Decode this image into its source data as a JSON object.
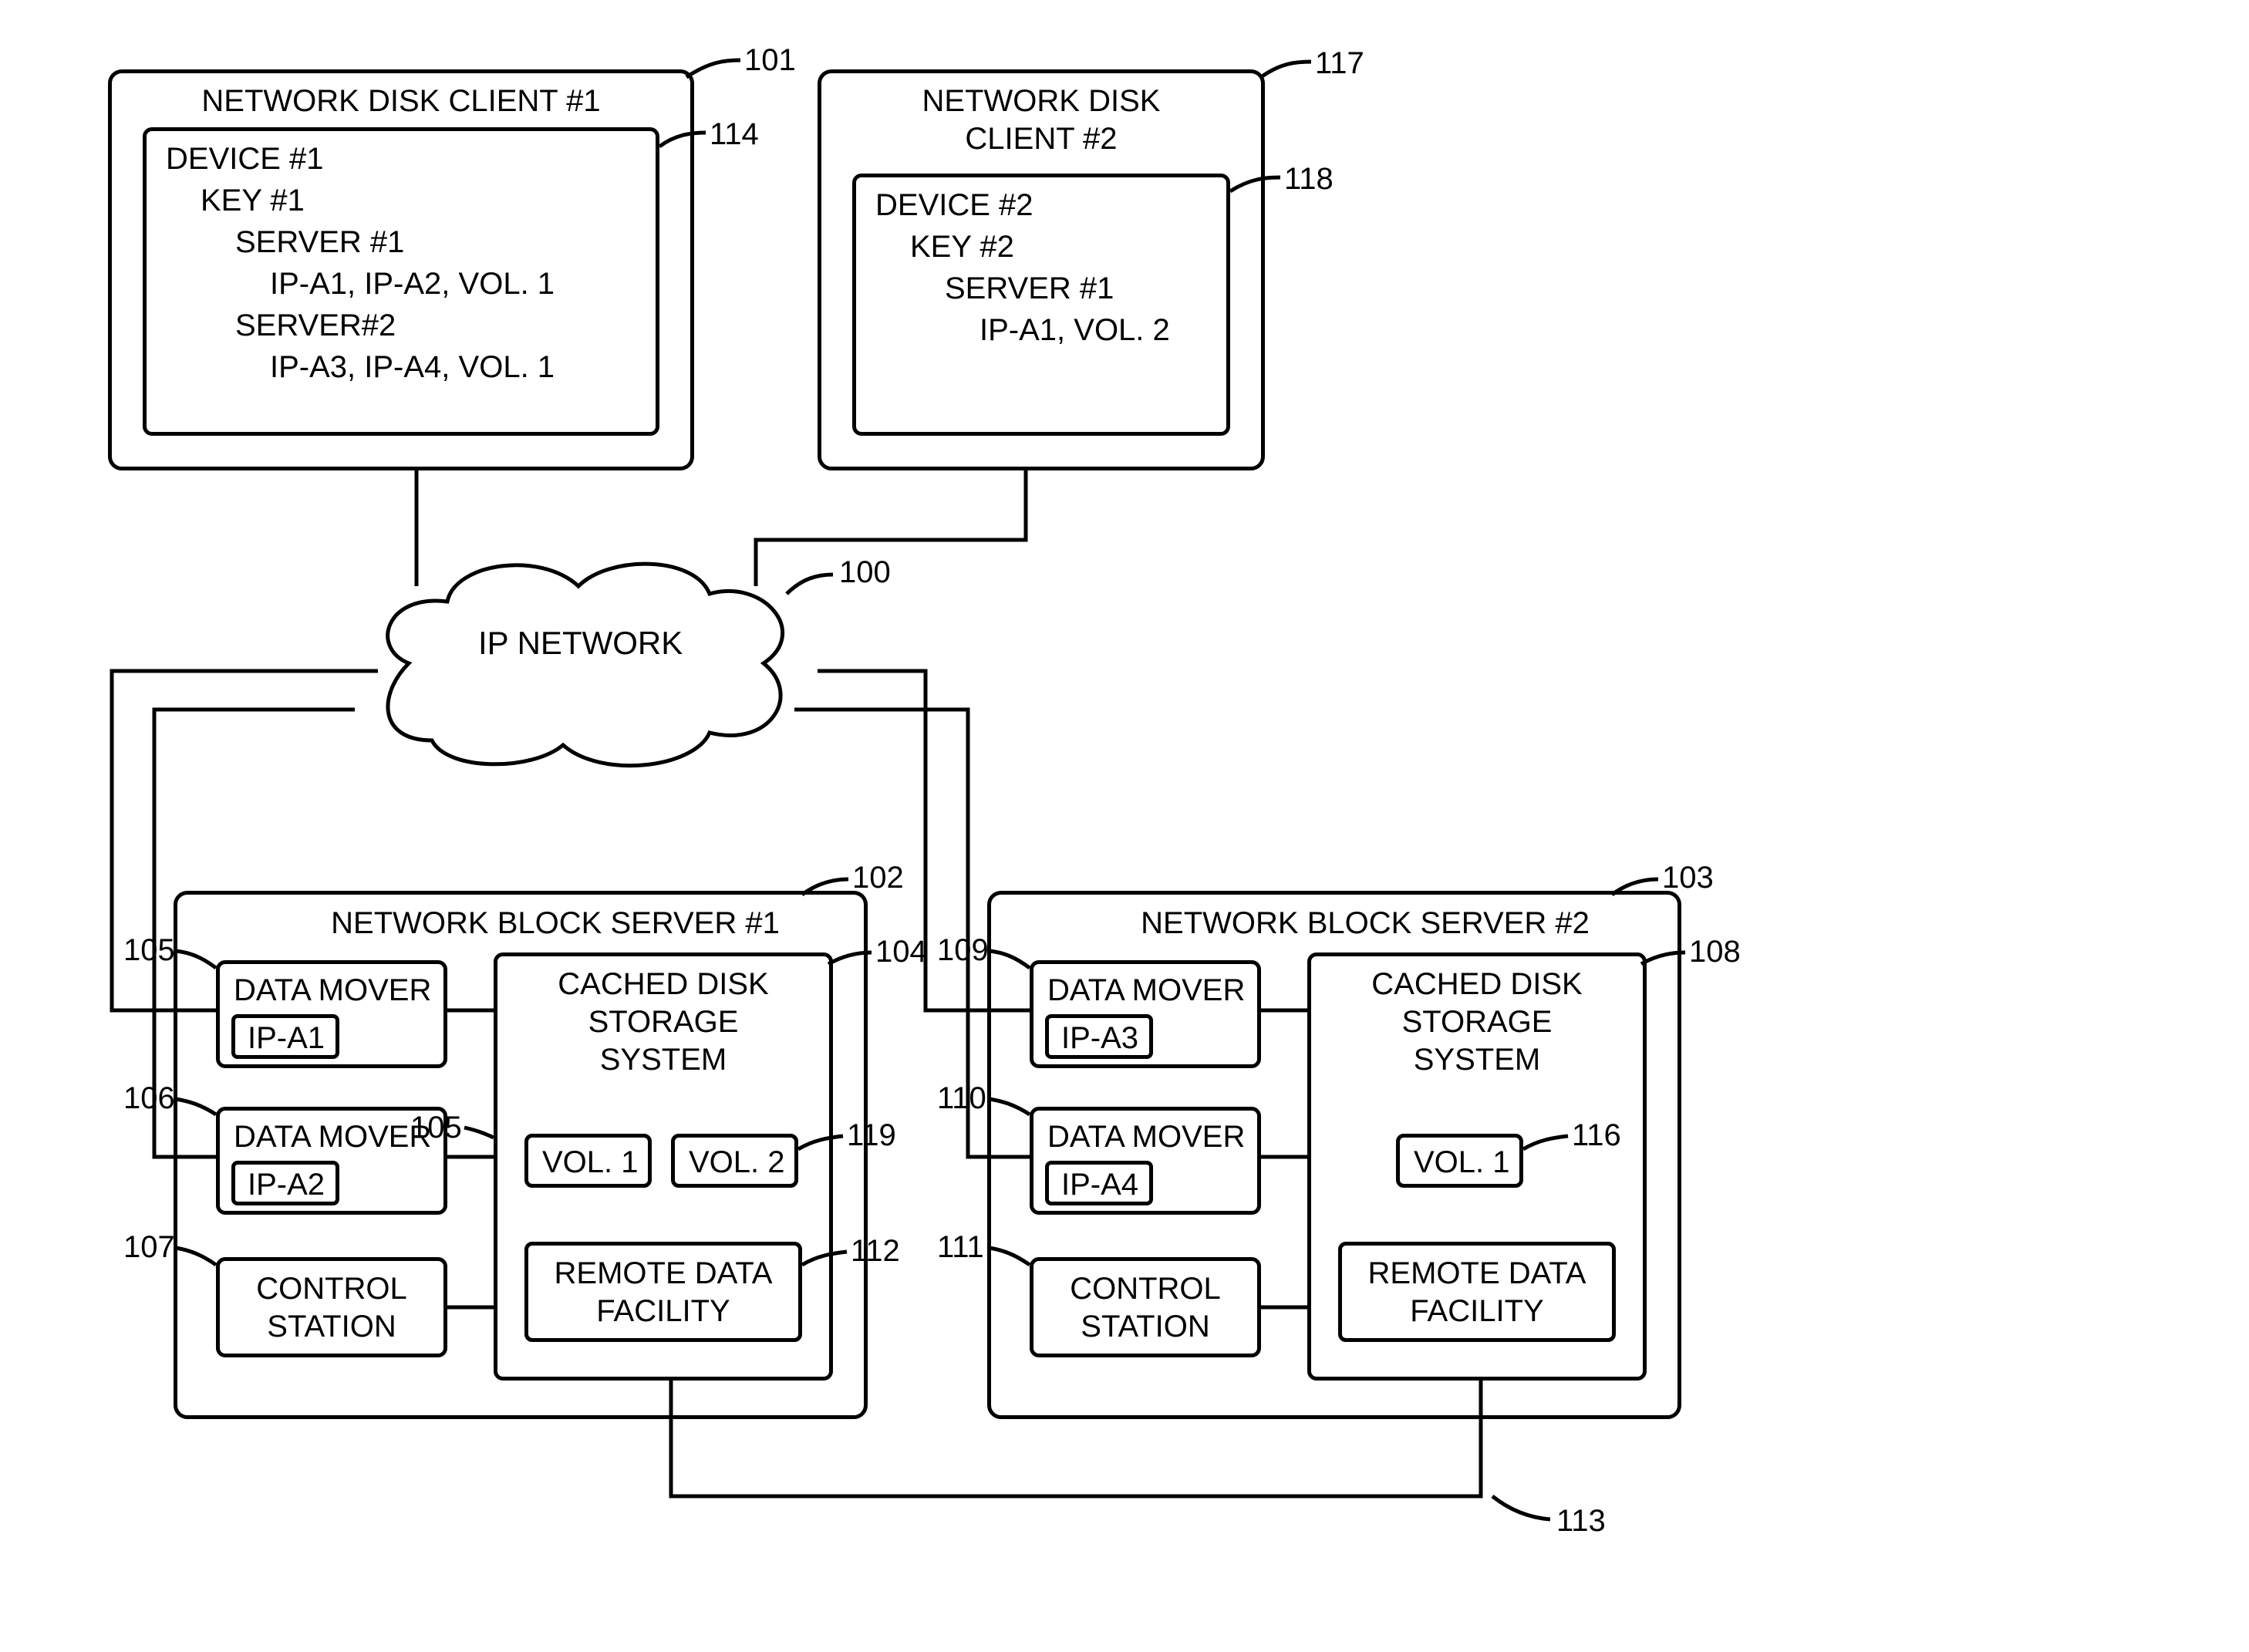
{
  "client1": {
    "title": "NETWORK DISK CLIENT #1",
    "dev": "DEVICE #1",
    "key": "KEY #1",
    "srv1": "SERVER #1",
    "srv1_cfg": "IP-A1, IP-A2, VOL. 1",
    "srv2": "SERVER#2",
    "srv2_cfg": "IP-A3, IP-A4, VOL. 1"
  },
  "client2": {
    "title_l1": "NETWORK DISK",
    "title_l2": "CLIENT #2",
    "dev": "DEVICE #2",
    "key": "KEY #2",
    "srv1": "SERVER #1",
    "srv1_cfg": "IP-A1, VOL. 2"
  },
  "network": "IP NETWORK",
  "server1": {
    "title": "NETWORK BLOCK SERVER #1",
    "dm1": "DATA MOVER",
    "dm1_ip": "IP-A1",
    "dm2": "DATA MOVER",
    "dm2_ip": "IP-A2",
    "ctrl_l1": "CONTROL",
    "ctrl_l2": "STATION",
    "cds_l1": "CACHED DISK",
    "cds_l2": "STORAGE",
    "cds_l3": "SYSTEM",
    "vol1": "VOL. 1",
    "vol2": "VOL. 2",
    "rdf_l1": "REMOTE DATA",
    "rdf_l2": "FACILITY"
  },
  "server2": {
    "title": "NETWORK BLOCK SERVER #2",
    "dm1": "DATA MOVER",
    "dm1_ip": "IP-A3",
    "dm2": "DATA MOVER",
    "dm2_ip": "IP-A4",
    "ctrl_l1": "CONTROL",
    "ctrl_l2": "STATION",
    "cds_l1": "CACHED DISK",
    "cds_l2": "STORAGE",
    "cds_l3": "SYSTEM",
    "vol1": "VOL. 1",
    "rdf_l1": "REMOTE DATA",
    "rdf_l2": "FACILITY"
  },
  "refs": {
    "r100": "100",
    "r101": "101",
    "r102": "102",
    "r103": "103",
    "r104": "104",
    "r105a": "105",
    "r105b": "105",
    "r106": "106",
    "r107": "107",
    "r108": "108",
    "r109": "109",
    "r110": "110",
    "r111": "111",
    "r112": "112",
    "r113": "113",
    "r114": "114",
    "r116": "116",
    "r117": "117",
    "r118": "118",
    "r119": "119"
  }
}
